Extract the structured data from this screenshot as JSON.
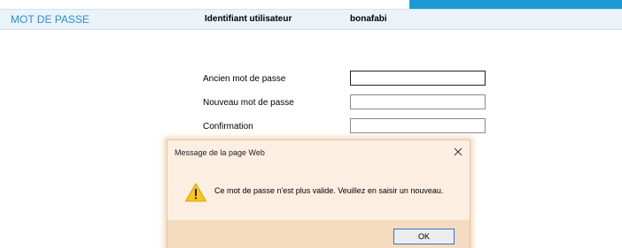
{
  "header": {
    "title": "MOT DE PASSE",
    "user_label": "Identifiant utilisateur",
    "user_value": "bonafabi"
  },
  "form": {
    "old_password_label": "Ancien mot de passe",
    "old_password_value": "",
    "new_password_label": "Nouveau mot de passe",
    "new_password_value": "",
    "confirm_label": "Confirmation",
    "confirm_value": ""
  },
  "dialog": {
    "title": "Message de la page Web",
    "message": "Ce mot de passe n'est plus valide. Veuillez en saisir un nouveau.",
    "ok_label": "OK",
    "close_icon": "close-icon",
    "warning_icon": "warning-icon"
  },
  "colors": {
    "accent": "#1c9ad6",
    "header_bg": "#eaf2fa",
    "title_color": "#2a8fce",
    "dialog_bg": "#fcefe2",
    "dialog_footer_bg": "#f5dcc0",
    "warning_yellow": "#f7c617"
  }
}
